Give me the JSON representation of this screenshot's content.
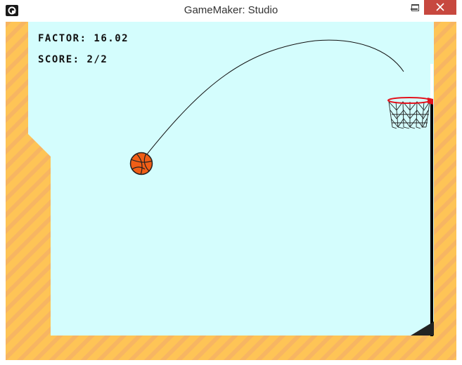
{
  "window": {
    "title": "GameMaker: Studio",
    "controls": {
      "minimize_icon": "minimize-icon",
      "maximize_icon": "maximize-icon",
      "close_icon": "close-icon",
      "close_glyph": "✕"
    }
  },
  "hud": {
    "factor_label": "FACTOR: 16.02",
    "score_label": "SCORE: 2/2"
  },
  "colors": {
    "sky": "#d4fdfd",
    "wall": "#fec456",
    "wall_stripe": "#f7ad6a",
    "ball": "#f05e16",
    "rim": "#e3121d",
    "net": "#222222",
    "pole": "#000000",
    "close_button": "#c7483f"
  },
  "icons": {
    "app": "gamemaker-icon",
    "ball": "basketball-icon",
    "hoop": "basketball-hoop-icon"
  }
}
